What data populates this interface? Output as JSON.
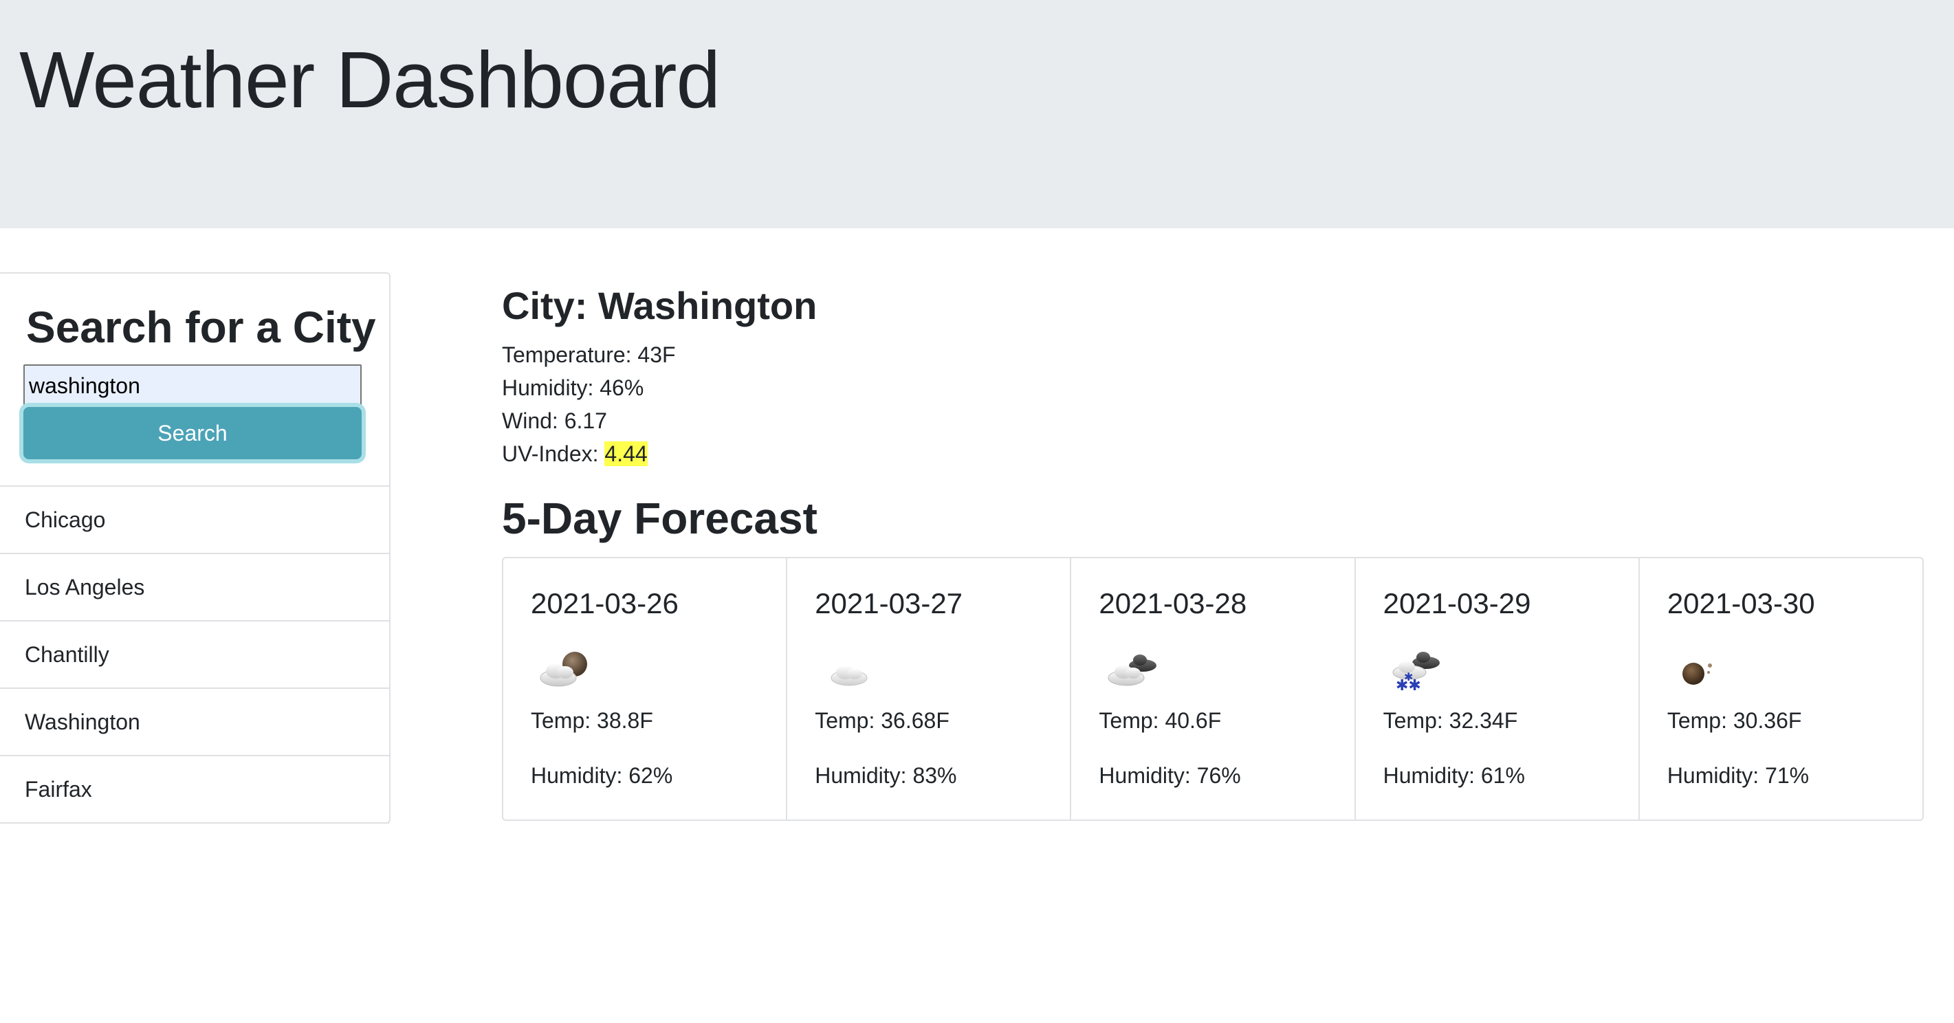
{
  "header": {
    "title": "Weather Dashboard"
  },
  "search": {
    "heading": "Search for a City",
    "input_value": "washington",
    "button_label": "Search"
  },
  "history": [
    "Chicago",
    "Los Angeles",
    "Chantilly",
    "Washington",
    "Fairfax"
  ],
  "current": {
    "city_label": "City: Washington",
    "temperature": "Temperature: 43F",
    "humidity": "Humidity: 46%",
    "wind": "Wind: 6.17",
    "uv_label": "UV-Index: ",
    "uv_value": "4.44",
    "uv_color": "#ffff4d"
  },
  "forecast": {
    "title": "5-Day Forecast",
    "days": [
      {
        "date": "2021-03-26",
        "icon": "partly-cloudy-night-icon",
        "temp": "Temp: 38.8F",
        "humidity": "Humidity: 62%"
      },
      {
        "date": "2021-03-27",
        "icon": "cloud-icon",
        "temp": "Temp: 36.68F",
        "humidity": "Humidity: 83%"
      },
      {
        "date": "2021-03-28",
        "icon": "broken-clouds-icon",
        "temp": "Temp: 40.6F",
        "humidity": "Humidity: 76%"
      },
      {
        "date": "2021-03-29",
        "icon": "snow-icon",
        "temp": "Temp: 32.34F",
        "humidity": "Humidity: 61%"
      },
      {
        "date": "2021-03-30",
        "icon": "clear-night-icon",
        "temp": "Temp: 30.36F",
        "humidity": "Humidity: 71%"
      }
    ]
  },
  "colors": {
    "header_bg": "#e9ecef",
    "button_bg": "#4ba3b6",
    "uv_highlight": "#ffff4d"
  }
}
